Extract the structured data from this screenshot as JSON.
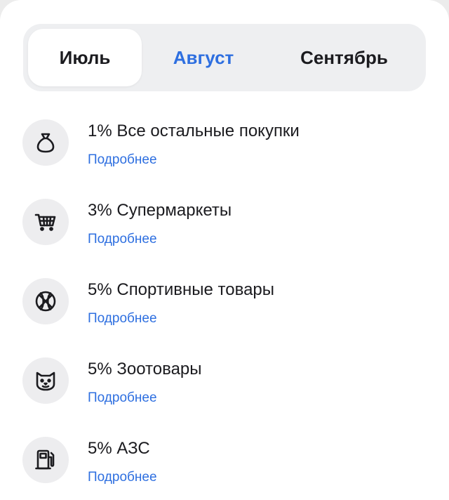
{
  "tabs": [
    {
      "label": "Июль",
      "active": true
    },
    {
      "label": "Август",
      "accent": true
    },
    {
      "label": "Сентябрь"
    }
  ],
  "categories": [
    {
      "title": "1% Все остальные покупки",
      "link": "Подробнее",
      "icon": "money-bag-icon"
    },
    {
      "title": "3% Супермаркеты",
      "link": "Подробнее",
      "icon": "shopping-cart-icon"
    },
    {
      "title": "5% Спортивные товары",
      "link": "Подробнее",
      "icon": "basketball-icon"
    },
    {
      "title": "5% Зоотовары",
      "link": "Подробнее",
      "icon": "cat-face-icon"
    },
    {
      "title": "5% АЗС",
      "link": "Подробнее",
      "icon": "fuel-pump-icon"
    }
  ],
  "colors": {
    "accent": "#2e6fe0",
    "text": "#1b1b1f",
    "icon_bg": "#ededef",
    "segment_bg": "#eeeff1"
  }
}
